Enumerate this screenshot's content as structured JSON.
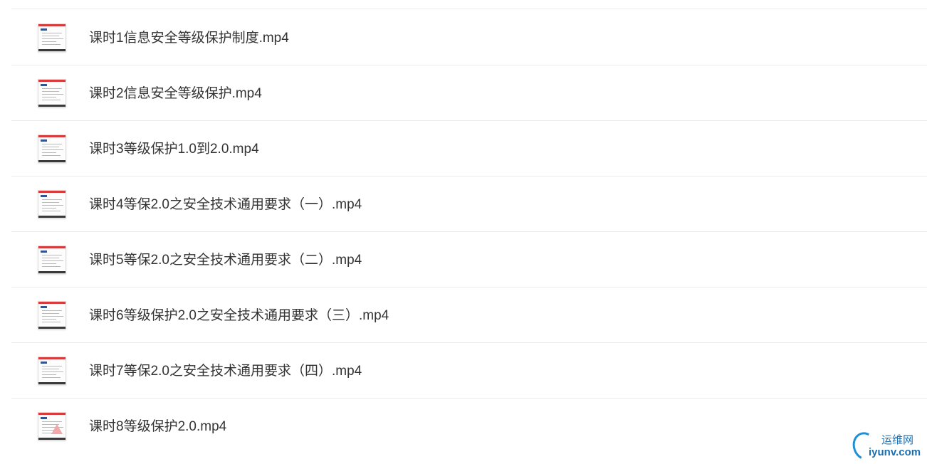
{
  "files": [
    {
      "name": "课时1信息安全等级保护制度.mp4",
      "icon": "document-thumbnail-icon"
    },
    {
      "name": "课时2信息安全等级保护.mp4",
      "icon": "document-thumbnail-icon"
    },
    {
      "name": "课时3等级保护1.0到2.0.mp4",
      "icon": "document-thumbnail-icon"
    },
    {
      "name": "课时4等保2.0之安全技术通用要求（一）.mp4",
      "icon": "document-thumbnail-icon"
    },
    {
      "name": "课时5等保2.0之安全技术通用要求（二）.mp4",
      "icon": "document-thumbnail-icon"
    },
    {
      "name": "课时6等级保护2.0之安全技术通用要求（三）.mp4",
      "icon": "document-thumbnail-icon"
    },
    {
      "name": "课时7等保2.0之安全技术通用要求（四）.mp4",
      "icon": "document-thumbnail-icon"
    },
    {
      "name": "课时8等级保护2.0.mp4",
      "icon": "document-thumbnail-icon"
    }
  ],
  "watermark": {
    "chinese": "运维网",
    "domain": "iyunv.com"
  },
  "colors": {
    "text": "#333333",
    "divider": "#ececec",
    "thumbnail_accent": "#d83b3b",
    "watermark": "#1a6fb3"
  }
}
